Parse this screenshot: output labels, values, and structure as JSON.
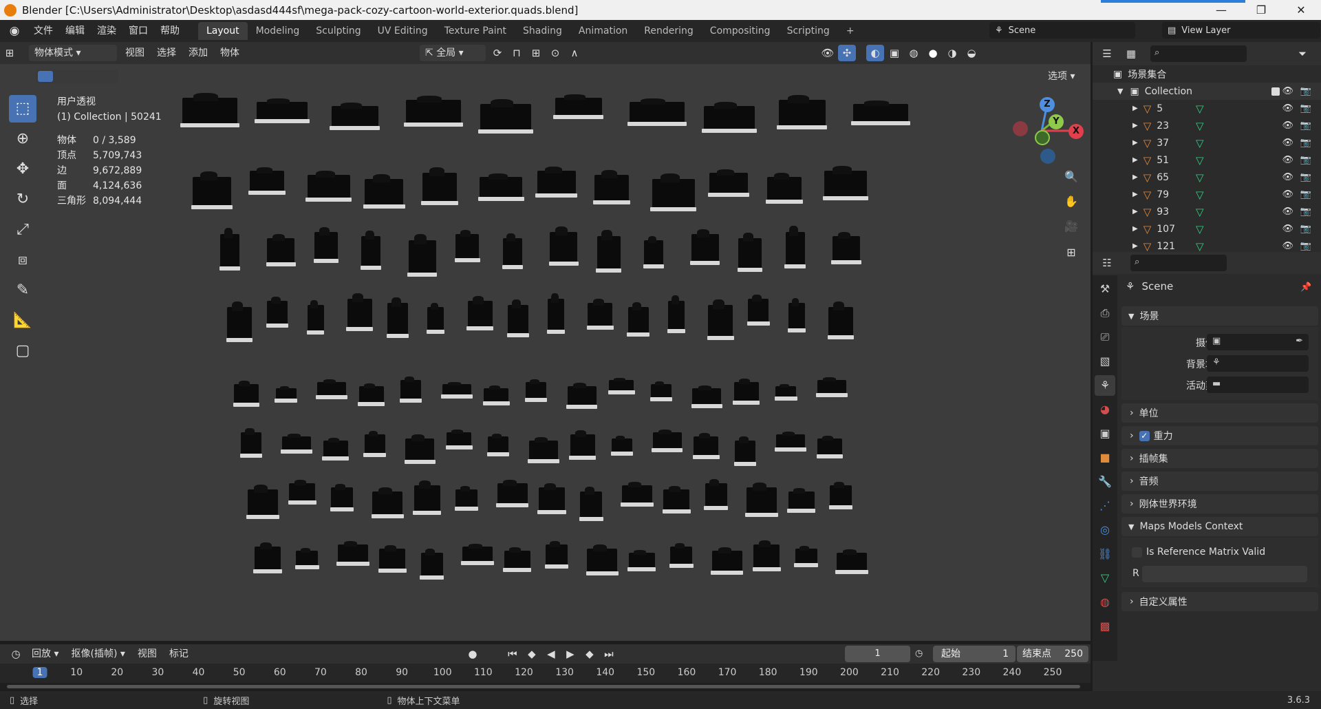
{
  "window": {
    "title": "Blender [C:\\Users\\Administrator\\Desktop\\asdasd444sf\\mega-pack-cozy-cartoon-world-exterior.quads.blend]",
    "controls": [
      "—",
      "❐",
      "✕"
    ]
  },
  "menu": [
    "文件",
    "编辑",
    "渲染",
    "窗口",
    "帮助"
  ],
  "workspaces": [
    "Layout",
    "Modeling",
    "Sculpting",
    "UV Editing",
    "Texture Paint",
    "Shading",
    "Animation",
    "Rendering",
    "Compositing",
    "Scripting",
    "+"
  ],
  "active_workspace": "Layout",
  "scene_name": "Scene",
  "view_layer": "View Layer",
  "viewport_header": {
    "mode": "物体模式",
    "menus": [
      "视图",
      "选择",
      "添加",
      "物体"
    ],
    "transform_orientation": "全局",
    "options_label": "选项"
  },
  "stats": {
    "view_name": "用户透视",
    "collection": "(1) Collection | 50241",
    "rows": [
      {
        "k": "物体",
        "v": "0 / 3,589"
      },
      {
        "k": "顶点",
        "v": "5,709,743"
      },
      {
        "k": "边",
        "v": "9,672,889"
      },
      {
        "k": "面",
        "v": "4,124,636"
      },
      {
        "k": "三角形",
        "v": "8,094,444"
      }
    ]
  },
  "gizmo": {
    "z": "Z",
    "y": "Y",
    "x": "X"
  },
  "outliner": {
    "root": "场景集合",
    "collection": "Collection",
    "items": [
      "5",
      "23",
      "37",
      "51",
      "65",
      "79",
      "93",
      "107",
      "121"
    ]
  },
  "properties": {
    "scene_title": "Scene",
    "section_scene": "场景",
    "camera_label": "摄像机",
    "bg_scene_label": "背景场景",
    "active_clip_label": "活动剪辑",
    "panels": [
      "单位",
      "重力",
      "插帧集",
      "音频",
      "刚体世界环境",
      "Maps Models Context",
      "自定义属性"
    ],
    "gravity_checked": true,
    "matrix_label": "Is Reference Matrix Valid",
    "r_label": "R"
  },
  "timeline": {
    "playback": "回放",
    "keying": "抠像(插帧)",
    "view": "视图",
    "marker": "标记",
    "current_frame": "1",
    "start_label": "起始",
    "start": "1",
    "end_label": "结束点",
    "end": "250",
    "ruler": [
      "1",
      "10",
      "20",
      "30",
      "40",
      "50",
      "60",
      "70",
      "80",
      "90",
      "100",
      "110",
      "120",
      "130",
      "140",
      "150",
      "160",
      "170",
      "180",
      "190",
      "200",
      "210",
      "220",
      "230",
      "240",
      "250"
    ]
  },
  "statusbar": {
    "select": "选择",
    "rotate": "旋转视图",
    "context": "物体上下文菜单",
    "version": "3.6.3"
  }
}
